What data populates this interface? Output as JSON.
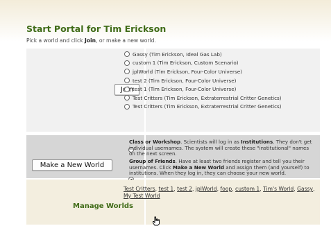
{
  "header": {
    "title": "Start Portal for Tim Erickson",
    "subtitle_prefix": "Pick a world and click ",
    "subtitle_bold": "Join",
    "subtitle_suffix": ", or make a new world."
  },
  "join": {
    "button_label": "Join",
    "worlds": [
      {
        "label": "Gassy (Tim Erickson, Ideal Gas Lab)",
        "selected": false
      },
      {
        "label": "custom 1 (Tim Erickson, Custom Scenario)",
        "selected": false
      },
      {
        "label": "jplWorld (Tim Erickson, Four-Color Universe)",
        "selected": false
      },
      {
        "label": "test 2 (Tim Erickson, Four-Color Universe)",
        "selected": false
      },
      {
        "label": "test 1 (Tim Erickson, Four-Color Universe)",
        "selected": false
      },
      {
        "label": "Test Critters (Tim Erickson, Extraterrestrial Critter Genetics)",
        "selected": false
      },
      {
        "label": "Test Critters (Tim Erickson, Extraterrestrial Critter Genetics)",
        "selected": false
      }
    ]
  },
  "new_world": {
    "button_label": "Make a New World",
    "option_class": {
      "bold": "Class or Workshop",
      "text1": ". Scientists will log in as ",
      "bold2": "Institutions",
      "text2": ". They don't get individual usernames. The system will create these \"institutional\" names on the next screen.",
      "selected": false
    },
    "option_friends": {
      "bold": "Group of Friends",
      "text1": ". Have at least two friends register and tell you their usernames. Click ",
      "bold2": "Make a New World",
      "text2": " and assign them (and yourself) to institutions. When they log in, they can choose your new world.",
      "selected": true
    }
  },
  "manage": {
    "label": "Manage Worlds",
    "links": [
      "Test Critters",
      "test 1",
      "test 2",
      "jplWorld",
      "foop",
      "custom 1",
      "Tim's World",
      "Gassy",
      "My Test World"
    ]
  },
  "colors": {
    "title_green": "#3f6b17",
    "row_join_bg": "#f1f1f1",
    "row_new_bg": "#d6d6d6",
    "row_manage_bg": "#f3eedf"
  }
}
